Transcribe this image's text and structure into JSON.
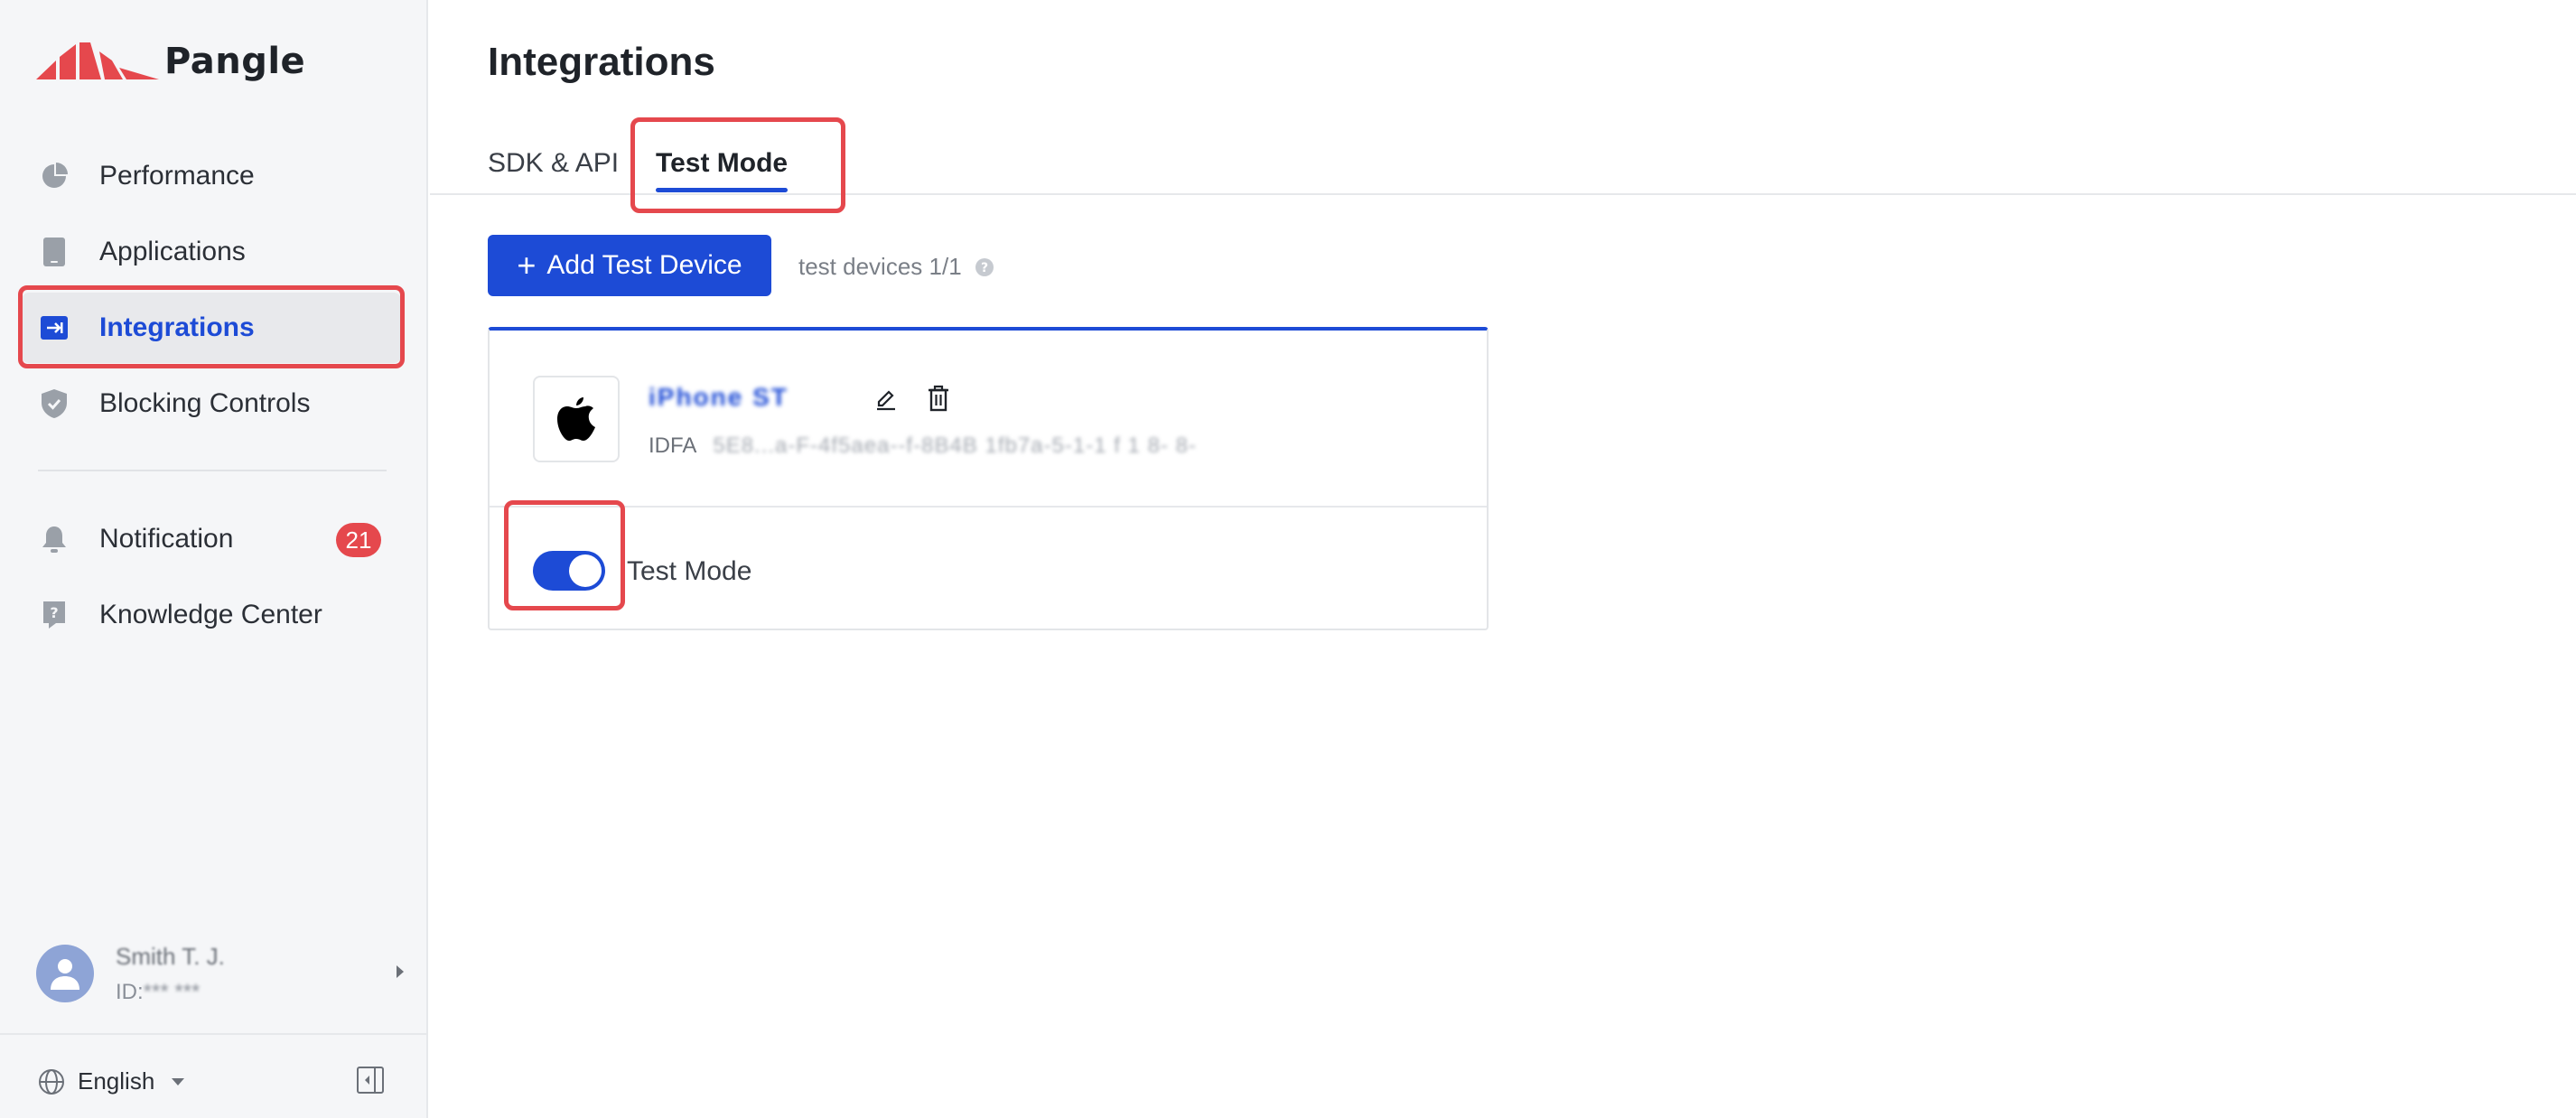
{
  "brand": {
    "name": "Pangle",
    "accent": "#1d4bd6",
    "logo_red": "#e5484d"
  },
  "sidebar": {
    "items": [
      {
        "label": "Performance",
        "icon": "pie-chart-icon"
      },
      {
        "label": "Applications",
        "icon": "tablet-icon"
      },
      {
        "label": "Integrations",
        "icon": "integration-icon"
      },
      {
        "label": "Blocking Controls",
        "icon": "shield-icon"
      },
      {
        "label": "Notification",
        "icon": "bell-icon",
        "badge": "21"
      },
      {
        "label": "Knowledge Center",
        "icon": "help-book-icon"
      }
    ],
    "user": {
      "name": "Smith T. J.",
      "id_label": "ID:",
      "id_value": "*** ***"
    },
    "language": "English"
  },
  "main": {
    "title": "Integrations",
    "tabs": [
      {
        "label": "SDK & API"
      },
      {
        "label": "Test Mode"
      }
    ],
    "add_button": {
      "plus": "+",
      "label": "Add Test Device"
    },
    "device_count": "test devices 1/1",
    "device": {
      "name": "iPhone ST",
      "idfa_label": "IDFA",
      "idfa_value": "5E8...a-F-4f5aea--f-8B4B 1fb7a-5-1-1 f 1 8- 8-",
      "test_mode_label": "Test Mode",
      "test_mode_on": true
    }
  }
}
